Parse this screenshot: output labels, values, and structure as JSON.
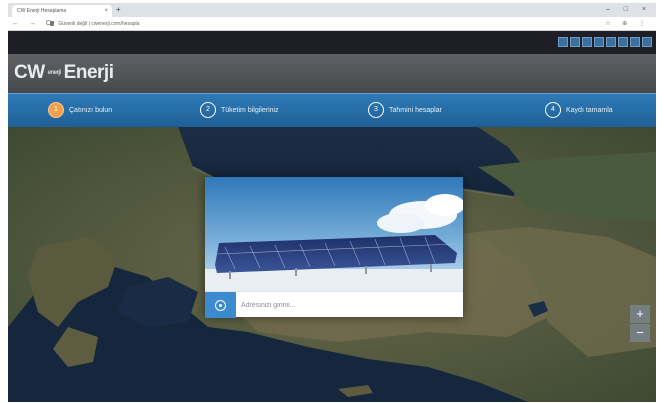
{
  "browser": {
    "tab_title": "CW Enerji Hesaplama",
    "tab_close": "×",
    "new_tab": "+",
    "url": "Güvenli değil  |  cwenerji.com/hesapla",
    "nav_buttons": "← → C",
    "window_controls": "– □ ×",
    "extension_icons": "☆ ⊕ ⋮"
  },
  "app": {
    "brand_name": "CW",
    "brand_sub": "enerji",
    "brand_word": "Enerji"
  },
  "steps": [
    {
      "number": "1",
      "label": "Çatınızı bulun",
      "active": true
    },
    {
      "number": "2",
      "label": "Tüketim bilgileriniz",
      "active": false
    },
    {
      "number": "3",
      "label": "Tahmini hesaplar",
      "active": false
    },
    {
      "number": "4",
      "label": "Kaydı tamamla",
      "active": false
    }
  ],
  "map": {
    "zoom_in": "+",
    "zoom_out": "−"
  },
  "modal": {
    "address_placeholder": "Adresinizi girinii..."
  },
  "colors": {
    "steps_bar": "#2a70aa",
    "active_step": "#f0a04a",
    "locate_button": "#3c8bd0"
  }
}
